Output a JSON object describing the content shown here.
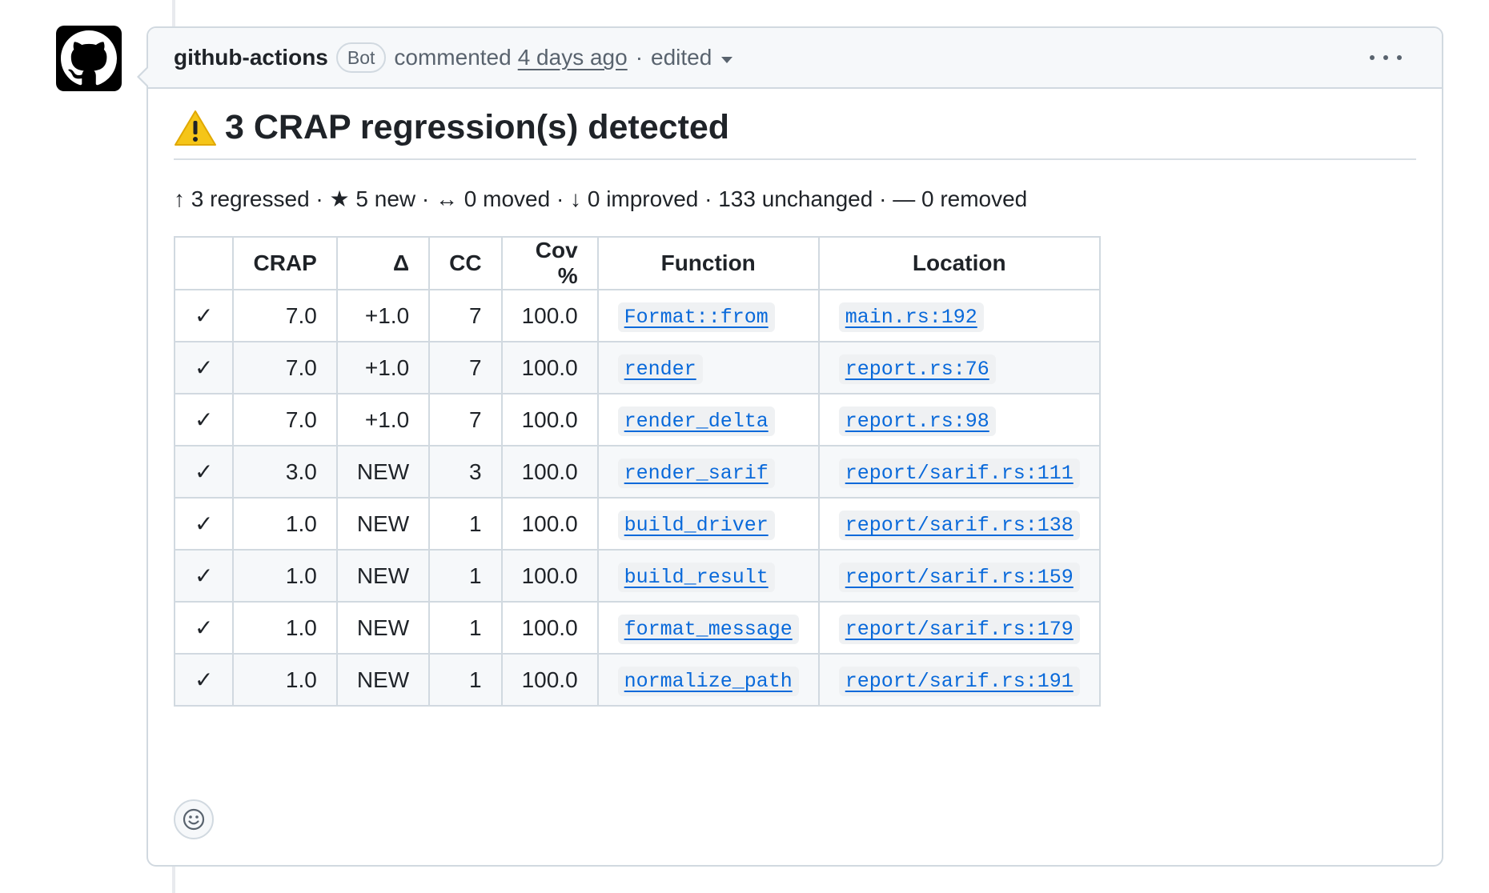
{
  "comment": {
    "author": "github-actions",
    "badge": "Bot",
    "action": "commented",
    "time": "4 days ago",
    "separator": "·",
    "edited": "edited"
  },
  "report": {
    "title": "3 CRAP regression(s) detected",
    "summary": "↑ 3 regressed · ★ 5 new · ↔ 0 moved · ↓ 0 improved · 133 unchanged · — 0 removed",
    "columns": [
      "",
      "CRAP",
      "Δ",
      "CC",
      "Cov %",
      "Function",
      "Location"
    ],
    "rows": [
      {
        "check": "✓",
        "crap": "7.0",
        "delta": "+1.0",
        "cc": "7",
        "cov": "100.0",
        "function": "Format::from",
        "location": "main.rs:192"
      },
      {
        "check": "✓",
        "crap": "7.0",
        "delta": "+1.0",
        "cc": "7",
        "cov": "100.0",
        "function": "render",
        "location": "report.rs:76"
      },
      {
        "check": "✓",
        "crap": "7.0",
        "delta": "+1.0",
        "cc": "7",
        "cov": "100.0",
        "function": "render_delta",
        "location": "report.rs:98"
      },
      {
        "check": "✓",
        "crap": "3.0",
        "delta": "NEW",
        "cc": "3",
        "cov": "100.0",
        "function": "render_sarif",
        "location": "report/sarif.rs:111"
      },
      {
        "check": "✓",
        "crap": "1.0",
        "delta": "NEW",
        "cc": "1",
        "cov": "100.0",
        "function": "build_driver",
        "location": "report/sarif.rs:138"
      },
      {
        "check": "✓",
        "crap": "1.0",
        "delta": "NEW",
        "cc": "1",
        "cov": "100.0",
        "function": "build_result",
        "location": "report/sarif.rs:159"
      },
      {
        "check": "✓",
        "crap": "1.0",
        "delta": "NEW",
        "cc": "1",
        "cov": "100.0",
        "function": "format_message",
        "location": "report/sarif.rs:179"
      },
      {
        "check": "✓",
        "crap": "1.0",
        "delta": "NEW",
        "cc": "1",
        "cov": "100.0",
        "function": "normalize_path",
        "location": "report/sarif.rs:191"
      }
    ]
  },
  "icons": {
    "avatar": "github-octocat-icon",
    "warning": "warning-icon",
    "menu": "kebab-icon",
    "reaction": "smiley-icon",
    "dropdown": "chevron-down-icon"
  },
  "colors": {
    "link": "#0969da",
    "border": "#d1d9e0",
    "header_bg": "#f6f8fa",
    "muted_text": "#59636e",
    "warning": "#f5c518"
  }
}
